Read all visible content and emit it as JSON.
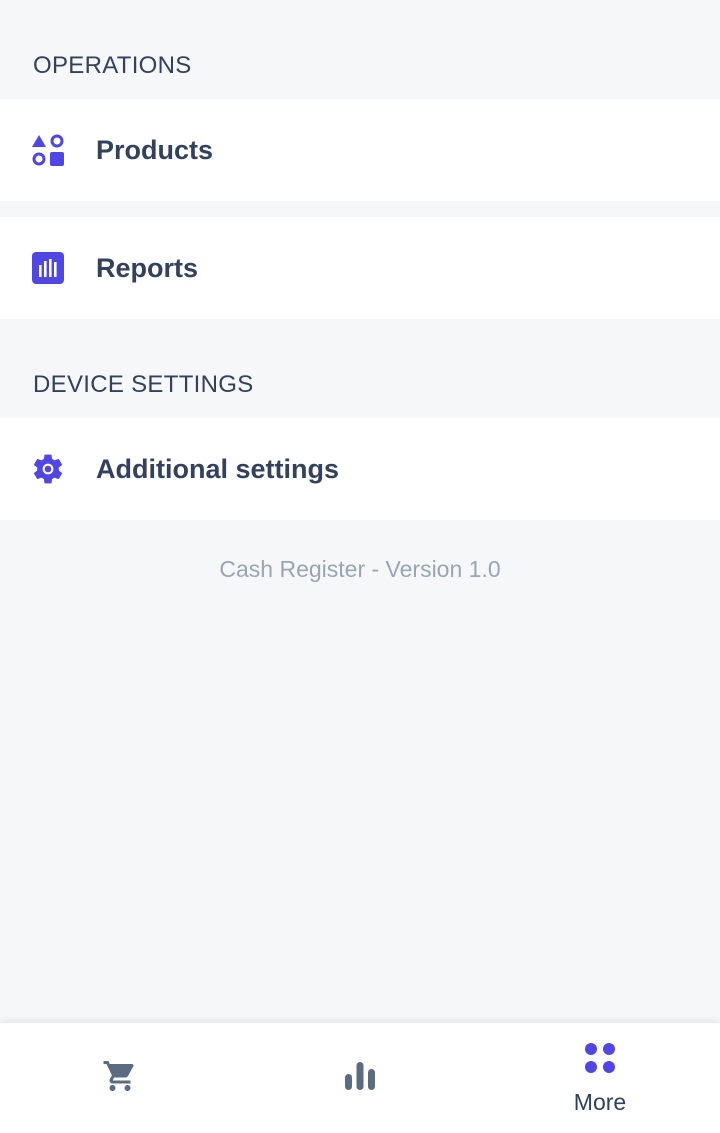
{
  "sections": {
    "operations": {
      "title": "OPERATIONS",
      "items": [
        {
          "label": "Products",
          "icon": "products-shapes-icon"
        },
        {
          "label": "Reports",
          "icon": "reports-chart-icon"
        }
      ]
    },
    "device_settings": {
      "title": "DEVICE SETTINGS",
      "items": [
        {
          "label": "Additional settings",
          "icon": "gear-icon"
        }
      ]
    }
  },
  "version_text": "Cash Register - Version 1.0",
  "bottom_nav": {
    "items": [
      {
        "icon": "cart-icon",
        "label": ""
      },
      {
        "icon": "bar-chart-icon",
        "label": ""
      },
      {
        "icon": "grid-dots-icon",
        "label": "More"
      }
    ],
    "active": "More"
  },
  "colors": {
    "accent": "#4f46e5",
    "text": "#33415c",
    "muted": "#9aa5b4",
    "nav_icon": "#5a6b82",
    "background": "#f6f7f9"
  }
}
